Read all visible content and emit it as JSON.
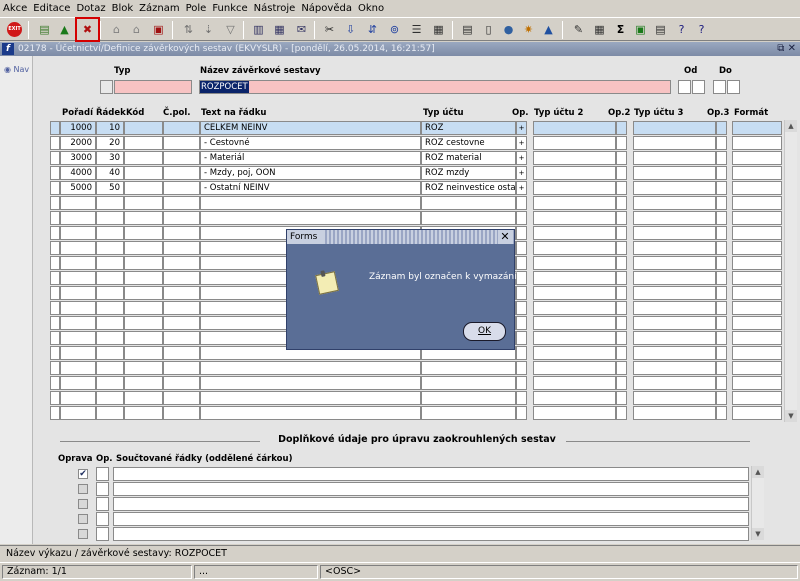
{
  "menu": [
    "Akce",
    "Editace",
    "Dotaz",
    "Blok",
    "Záznam",
    "Pole",
    "Funkce",
    "Nástroje",
    "Nápověda",
    "Okno"
  ],
  "toolbar": {
    "exit_label": "EXIT",
    "icons": [
      "exit-icon",
      "save-icon",
      "save-green-icon",
      "delete-record-icon",
      "query-icon",
      "query-execute-icon",
      "delete-icon",
      "sort-icon",
      "sort-down-icon",
      "filter-icon",
      "print-icon",
      "preview-icon",
      "mail-icon",
      "cut-icon",
      "copy-icon",
      "paste-icon",
      "search-icon",
      "list-icon",
      "calculator-icon",
      "document-icon",
      "globe-icon",
      "sun-icon",
      "triangle-icon",
      "edit-icon",
      "table-icon",
      "sigma-icon",
      "excel-icon",
      "calc-icon",
      "help-icon",
      "question-icon"
    ]
  },
  "window": {
    "title": "02178 - Účetnictví/Definice závěrkových sestav (EKVYSLR) - [pondělí, 26.05.2014, 16:21:57]"
  },
  "nav_label": "Nav",
  "header": {
    "typ_label": "Typ",
    "nazev_label": "Název závěrkové sestavy",
    "nazev_value": "ROZPOCET",
    "od_label": "Od",
    "do_label": "Do"
  },
  "table": {
    "columns": [
      "Pořadí",
      "Řádek",
      "Kód",
      "Č.pol.",
      "Text na řádku",
      "Typ účtu",
      "Op.",
      "Typ účtu 2",
      "Op.2",
      "Typ účtu 3",
      "Op.3",
      "Formát"
    ],
    "rows": [
      {
        "poradi": "1000",
        "radek": "10",
        "text": "CELKEM NEINV",
        "typ": "ROZ",
        "op": "+"
      },
      {
        "poradi": "2000",
        "radek": "20",
        "text": "- Cestovné",
        "typ": "ROZ cestovne",
        "op": "+"
      },
      {
        "poradi": "3000",
        "radek": "30",
        "text": "- Materiál",
        "typ": "ROZ material",
        "op": "+"
      },
      {
        "poradi": "4000",
        "radek": "40",
        "text": "- Mzdy, poj, OON",
        "typ": "ROZ mzdy",
        "op": "+"
      },
      {
        "poradi": "5000",
        "radek": "50",
        "text": "- Ostatní NEINV",
        "typ": "ROZ neinvestice ostatní",
        "op": "+"
      }
    ]
  },
  "section": {
    "title": "Doplňkové údaje pro úpravu zaokrouhlených sestav",
    "oprava_label": "Oprava",
    "op_label": "Op.",
    "rows_label": "Součtované řádky (oddělené čárkou)"
  },
  "dialog": {
    "title": "Forms",
    "message": "Záznam byl označen k vymazání.",
    "ok_label": "OK",
    "close": "✕"
  },
  "status": {
    "line1": "Název výkazu / závěrkové sestavy: ROZPOCET",
    "record": "Záznam: 1/1",
    "dots": "...",
    "osc": "<OSC>"
  }
}
